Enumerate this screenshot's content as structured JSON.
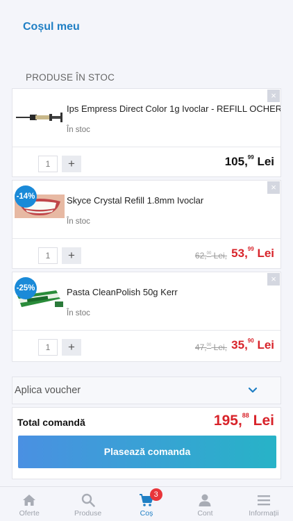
{
  "header": {
    "title": "Coșul meu"
  },
  "section": {
    "label": "PRODUSE ÎN STOC"
  },
  "items": [
    {
      "name": "Ips Empress Direct Color 1g Ivoclar - REFILL OCHER",
      "stock": "În stoc",
      "quantity": "1",
      "plus": "+",
      "close": "×",
      "price_int": "105,",
      "price_dec": "99",
      "currency": "Lei"
    },
    {
      "name": "Skyce Crystal Refill 1.8mm Ivoclar",
      "stock": "În stoc",
      "quantity": "1",
      "plus": "+",
      "close": "×",
      "badge": "-14%",
      "old_int": "62,",
      "old_dec": "00",
      "old_currency": "Lei,",
      "price_int": "53,",
      "price_dec": "99",
      "currency": "Lei"
    },
    {
      "name": "Pasta CleanPolish 50g Kerr",
      "stock": "În stoc",
      "quantity": "1",
      "plus": "+",
      "close": "×",
      "badge": "-25%",
      "old_int": "47,",
      "old_dec": "00",
      "old_currency": "Lei,",
      "price_int": "35,",
      "price_dec": "90",
      "currency": "Lei"
    }
  ],
  "voucher": {
    "label": "Aplica voucher"
  },
  "total": {
    "label": "Total comandă",
    "value_int": "195,",
    "value_dec": "88",
    "currency": "Lei",
    "button": "Plasează comanda"
  },
  "tabbar": {
    "tabs": [
      {
        "label": "Oferte",
        "icon": "home-icon"
      },
      {
        "label": "Produse",
        "icon": "search-icon"
      },
      {
        "label": "Coș",
        "icon": "cart-icon",
        "active": true,
        "badge": "3"
      },
      {
        "label": "Cont",
        "icon": "user-icon"
      },
      {
        "label": "Informații",
        "icon": "menu-icon"
      }
    ]
  },
  "colors": {
    "accent": "#1f7fc4",
    "sale": "#d8232a",
    "badge": "#1a8ad8"
  }
}
